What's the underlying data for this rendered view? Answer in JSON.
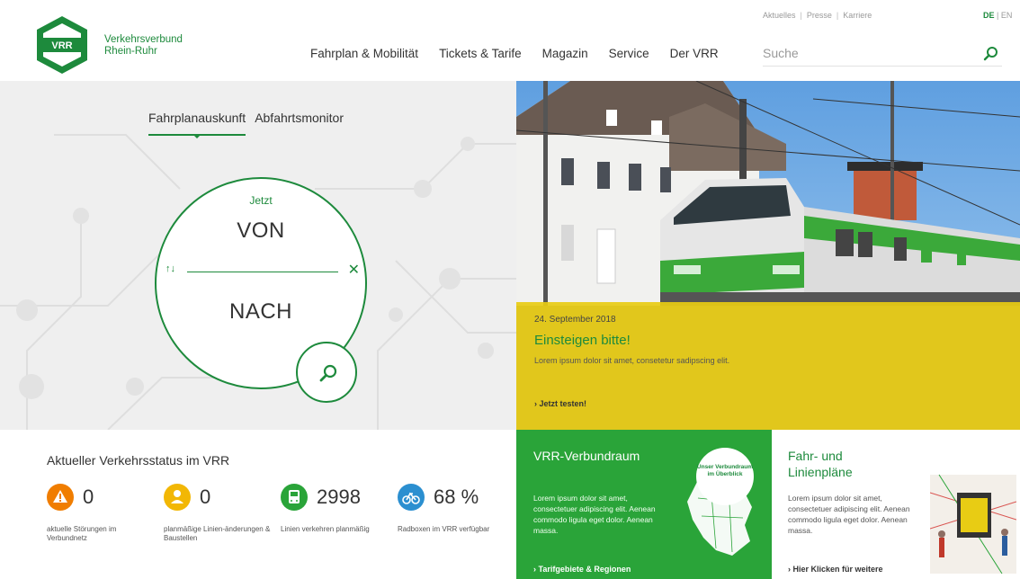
{
  "header": {
    "logo_text": "VRR",
    "brand_line1": "Verkehrsverbund",
    "brand_line2": "Rhein-Ruhr",
    "nav": [
      "Fahrplan & Mobilität",
      "Tickets & Tarife",
      "Magazin",
      "Service",
      "Der VRR"
    ],
    "meta_links": [
      "Aktuelles",
      "Presse",
      "Karriere"
    ],
    "languages": {
      "active": "DE",
      "other": "EN",
      "separator": "|"
    },
    "search": {
      "placeholder": "Suche",
      "icon": "search-icon"
    }
  },
  "planner": {
    "tabs": [
      "Fahrplanauskunft",
      "Abfahrtsmonitor"
    ],
    "active_tab": "Fahrplanauskunft",
    "time_label": "Jetzt",
    "from_placeholder": "VON",
    "to_placeholder": "NACH",
    "swap_icon": "↑↓",
    "clear_icon": "✕",
    "submit_icon": "search-icon"
  },
  "hero": {
    "date": "24. September 2018",
    "title": "Einsteigen bitte!",
    "text": "Lorem ipsum dolor sit amet, consetetur sadipscing elit.",
    "link": "Jetzt testen!",
    "caption_color": "#e8cc14"
  },
  "status": {
    "title": "Aktueller Verkehrsstatus im VRR",
    "items": [
      {
        "icon": "warning-icon",
        "color": "#f07d00",
        "value": "0",
        "label": "aktuelle Störungen im Verbundnetz"
      },
      {
        "icon": "construction-icon",
        "color": "#f2b705",
        "value": "0",
        "label": "planmäßige Linien-änderungen & Baustellen"
      },
      {
        "icon": "bus-icon",
        "color": "#2aa439",
        "value": "2998",
        "label": "Linien verkehren planmäßig"
      },
      {
        "icon": "bike-icon",
        "color": "#2b8fd0",
        "value": "68 %",
        "label": "Radboxen im VRR verfügbar"
      }
    ]
  },
  "teaser_green": {
    "title": "VRR-Verbundraum",
    "text": "Lorem ipsum dolor sit amet, consectetuer adipiscing elit. Aenean commodo ligula eget dolor. Aenean massa.",
    "badge": "Unser Verbundraum im Überblick",
    "link": "Tarifgebiete & Regionen",
    "color": "#2aa439"
  },
  "teaser_white": {
    "title": "Fahr- und Linienpläne",
    "text": "Lorem ipsum dolor sit amet, consectetuer adipiscing elit. Aenean commodo ligula eget dolor. Aenean massa.",
    "link": "Hier Klicken für weitere"
  },
  "colors": {
    "brand_green": "#1d8a3c",
    "accent_green": "#2aa439",
    "yellow": "#e8cc14"
  }
}
